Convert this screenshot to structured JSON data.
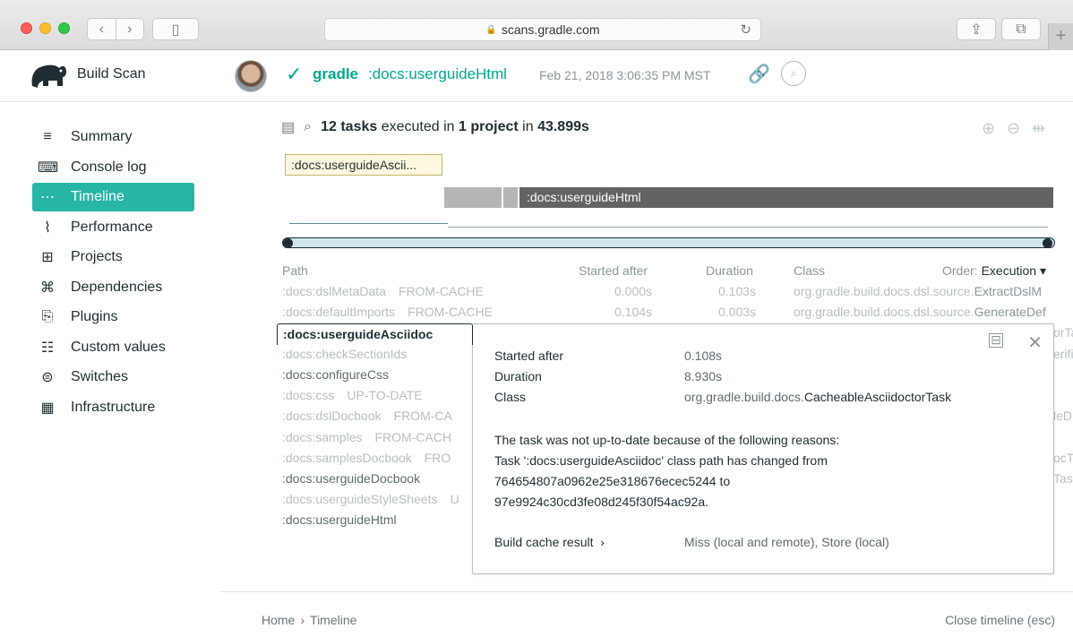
{
  "browser": {
    "url": "scans.gradle.com",
    "back_icon": "chevron-left",
    "forward_icon": "chevron-right",
    "plus_tab": "+"
  },
  "header": {
    "brand": "Build Scan",
    "project": "gradle",
    "task": ":docs:userguideHtml",
    "date": "Feb 21, 2018 3:06:35 PM MST",
    "status_color": "#02a88e"
  },
  "sidebar": {
    "items": [
      {
        "label": "Summary",
        "icon": "≡"
      },
      {
        "label": "Console log",
        "icon": "⌨"
      },
      {
        "label": "Timeline",
        "icon": "⋯"
      },
      {
        "label": "Performance",
        "icon": "⌇"
      },
      {
        "label": "Projects",
        "icon": "⊞"
      },
      {
        "label": "Dependencies",
        "icon": "⌘"
      },
      {
        "label": "Plugins",
        "icon": "⎘"
      },
      {
        "label": "Custom values",
        "icon": "☷"
      },
      {
        "label": "Switches",
        "icon": "⊜"
      },
      {
        "label": "Infrastructure",
        "icon": "▦"
      }
    ],
    "active_color": "#28b5a6"
  },
  "summary": {
    "tasks": "12 tasks",
    "executed_in": "executed in",
    "project": "1 project",
    "in": "in",
    "duration": "43.899s"
  },
  "timeline": {
    "tooltip_label": ":docs:userguideAscii...",
    "bar_label": ":docs:userguideHtml"
  },
  "table": {
    "headers": {
      "path": "Path",
      "started": "Started after",
      "duration": "Duration",
      "class": "Class",
      "order_label": "Order:",
      "order_value": "Execution ▾"
    },
    "rows": [
      {
        "path": ":docs:dslMetaData",
        "status": "FROM-CACHE",
        "started": "0.000s",
        "duration": "0.103s",
        "cls_prefix": "org.gradle.build.docs.dsl.source.",
        "cls_name": "ExtractDslM"
      },
      {
        "path": ":docs:defaultImports",
        "status": "FROM-CACHE",
        "started": "0.104s",
        "duration": "0.003s",
        "cls_prefix": "org.gradle.build.docs.dsl.source.",
        "cls_name": "GenerateDef"
      },
      {
        "path": ":docs:checkSectionIds",
        "status": ""
      },
      {
        "path": ":docs:configureCss",
        "status": ""
      },
      {
        "path": ":docs:css",
        "status": "UP-TO-DATE"
      },
      {
        "path": ":docs:dslDocbook",
        "status": "FROM-CA"
      },
      {
        "path": ":docs:samples",
        "status": "FROM-CACH"
      },
      {
        "path": ":docs:samplesDocbook",
        "status": "FRO"
      },
      {
        "path": ":docs:userguideDocbook",
        "status": ""
      },
      {
        "path": ":docs:userguideStyleSheets",
        "status": "U"
      },
      {
        "path": ":docs:userguideHtml",
        "status": ""
      }
    ],
    "right_fragments": [
      "orTa",
      "erifi",
      "leD",
      "ocTa",
      "Tas"
    ]
  },
  "selected": {
    "task": ":docs:userguideAsciidoc",
    "started_label": "Started after",
    "started_value": "0.108s",
    "duration_label": "Duration",
    "duration_value": "8.930s",
    "class_label": "Class",
    "class_prefix": "org.gradle.build.docs.",
    "class_name": "CacheableAsciidoctorTask",
    "reason_1": "The task was not up-to-date because of the following reasons:",
    "reason_2": "Task ':docs:userguideAsciidoc' class path has changed from",
    "reason_3": "764654807a0962e25e318676ecec5244 to",
    "reason_4": "97e9924c30cd3fe08d245f30f54ac92a.",
    "cache_label": "Build cache result",
    "cache_arrow": "›",
    "cache_value": "Miss (local and remote), Store (local)"
  },
  "footer": {
    "home": "Home",
    "sep": "›",
    "page": "Timeline",
    "close": "Close timeline (esc)"
  }
}
